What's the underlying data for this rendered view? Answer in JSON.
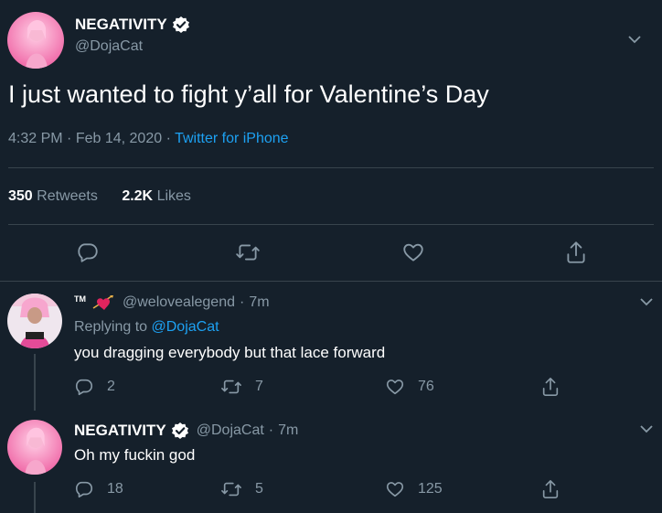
{
  "main_tweet": {
    "display_name": "NEGATIVITY",
    "handle": "@DojaCat",
    "text": "I just wanted to fight y’all for Valentine’s Day",
    "time": "4:32 PM",
    "date": "Feb 14, 2020",
    "source": "Twitter for iPhone",
    "retweets_count": "350",
    "retweets_label": "Retweets",
    "likes_count": "2.2K",
    "likes_label": "Likes"
  },
  "replies": [
    {
      "name_badge": "TM",
      "handle": "@welovealegend",
      "age": "7m",
      "replying_prefix": "Replying to",
      "replying_to": "@DojaCat",
      "text": "you dragging everybody but that lace forward",
      "replies_count": "2",
      "retweets_count": "7",
      "likes_count": "76"
    },
    {
      "display_name": "NEGATIVITY",
      "handle": "@DojaCat",
      "age": "7m",
      "text": "Oh my fuckin god",
      "replies_count": "18",
      "retweets_count": "5",
      "likes_count": "125"
    }
  ],
  "separators": {
    "dot": "·"
  },
  "colors": {
    "background": "#15202b",
    "divider": "#38444d",
    "muted": "#8899a6",
    "accent": "#1da1f2"
  }
}
